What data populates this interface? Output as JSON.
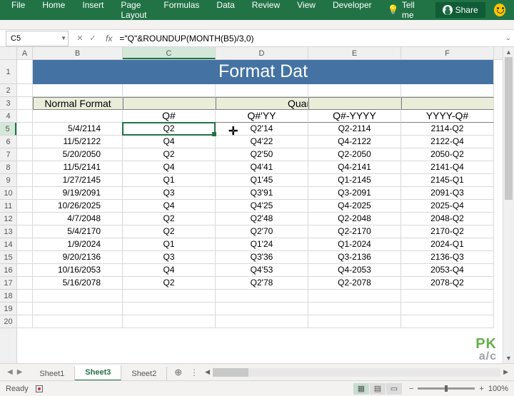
{
  "ribbon": {
    "tabs": [
      "File",
      "Home",
      "Insert",
      "Page Layout",
      "Formulas",
      "Data",
      "Review",
      "View",
      "Developer"
    ],
    "tellme": "Tell me",
    "share": "Share"
  },
  "namebox": "C5",
  "formula": "=\"Q\"&ROUNDUP(MONTH(B5)/3,0)",
  "columns": [
    "A",
    "B",
    "C",
    "D",
    "E",
    "F"
  ],
  "selected_col": "C",
  "selected_row": 5,
  "title": "Format Dates as Yearly Quarters",
  "hdr_normal": "Normal Format",
  "hdr_quarter": "Quarter Format",
  "subheaders": [
    "Q#",
    "Q#'YY",
    "Q#-YYYY",
    "YYYY-Q#"
  ],
  "rows": [
    {
      "r": 5,
      "b": "5/4/2114",
      "c": "Q2",
      "d": "Q2'14",
      "e": "Q2-2114",
      "f": "2114-Q2"
    },
    {
      "r": 6,
      "b": "11/5/2122",
      "c": "Q4",
      "d": "Q4'22",
      "e": "Q4-2122",
      "f": "2122-Q4"
    },
    {
      "r": 7,
      "b": "5/20/2050",
      "c": "Q2",
      "d": "Q2'50",
      "e": "Q2-2050",
      "f": "2050-Q2"
    },
    {
      "r": 8,
      "b": "11/5/2141",
      "c": "Q4",
      "d": "Q4'41",
      "e": "Q4-2141",
      "f": "2141-Q4"
    },
    {
      "r": 9,
      "b": "1/27/2145",
      "c": "Q1",
      "d": "Q1'45",
      "e": "Q1-2145",
      "f": "2145-Q1"
    },
    {
      "r": 10,
      "b": "9/19/2091",
      "c": "Q3",
      "d": "Q3'91",
      "e": "Q3-2091",
      "f": "2091-Q3"
    },
    {
      "r": 11,
      "b": "10/26/2025",
      "c": "Q4",
      "d": "Q4'25",
      "e": "Q4-2025",
      "f": "2025-Q4"
    },
    {
      "r": 12,
      "b": "4/7/2048",
      "c": "Q2",
      "d": "Q2'48",
      "e": "Q2-2048",
      "f": "2048-Q2"
    },
    {
      "r": 13,
      "b": "5/4/2170",
      "c": "Q2",
      "d": "Q2'70",
      "e": "Q2-2170",
      "f": "2170-Q2"
    },
    {
      "r": 14,
      "b": "1/9/2024",
      "c": "Q1",
      "d": "Q1'24",
      "e": "Q1-2024",
      "f": "2024-Q1"
    },
    {
      "r": 15,
      "b": "9/20/2136",
      "c": "Q3",
      "d": "Q3'36",
      "e": "Q3-2136",
      "f": "2136-Q3"
    },
    {
      "r": 16,
      "b": "10/16/2053",
      "c": "Q4",
      "d": "Q4'53",
      "e": "Q4-2053",
      "f": "2053-Q4"
    },
    {
      "r": 17,
      "b": "5/16/2078",
      "c": "Q2",
      "d": "Q2'78",
      "e": "Q2-2078",
      "f": "2078-Q2"
    }
  ],
  "sheets": [
    "Sheet1",
    "Sheet3",
    "Sheet2"
  ],
  "active_sheet": "Sheet3",
  "status": "Ready",
  "zoom": "100%",
  "watermark1": "PK",
  "watermark2": "a/c"
}
